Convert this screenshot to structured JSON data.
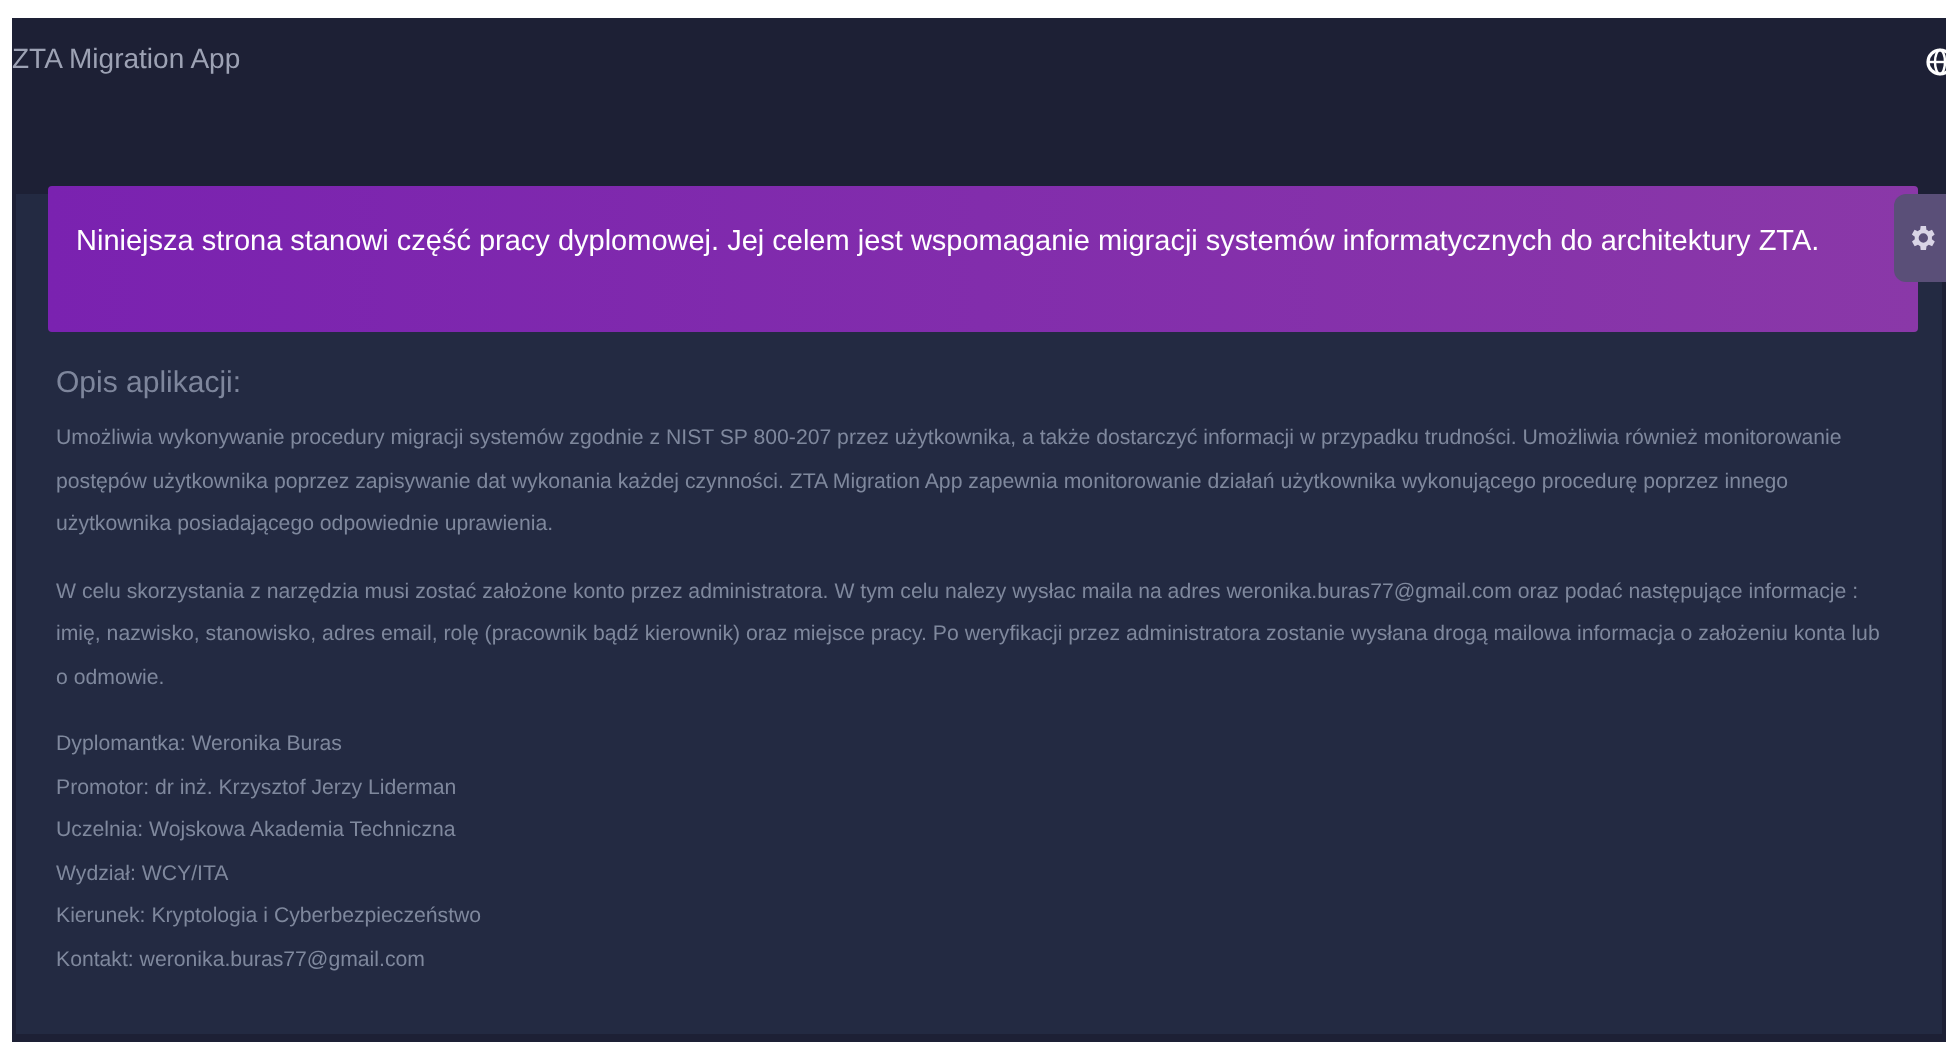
{
  "header": {
    "title": "ZTA Migration App"
  },
  "banner": {
    "text": "Niniejsza strona stanowi część pracy dyplomowej. Jej celem jest wspomaganie migracji systemów informatycznych do architektury ZTA."
  },
  "section": {
    "heading": "Opis aplikacji:",
    "paragraphs": [
      "Umożliwia wykonywanie procedury migracji systemów zgodnie z NIST SP 800-207 przez użytkownika, a także dostarczyć informacji w przypadku trudności. Umożliwia również monitorowanie postępów użytkownika poprzez zapisywanie dat wykonania każdej czynności. ZTA Migration App zapewnia monitorowanie działań użytkownika wykonującego procedurę poprzez innego użytkownika posiadającego odpowiednie uprawienia.",
      "W celu skorzystania z narzędzia musi zostać założone konto przez administratora. W tym celu nalezy wysłac maila na adres weronika.buras77@gmail.com oraz podać następujące informacje : imię, nazwisko, stanowisko, adres email, rolę (pracownik bądź kierownik) oraz miejsce pracy. Po weryfikacji przez administratora zostanie wysłana drogą mailowa informacja o założeniu konta lub o odmowie."
    ],
    "details": [
      "Dyplomantka: Weronika Buras",
      "Promotor: dr inż. Krzysztof Jerzy Liderman",
      "Uczelnia: Wojskowa Akademia Techniczna",
      "Wydział: WCY/ITA",
      "Kierunek: Kryptologia i Cyberbezpieczeństwo",
      "Kontakt: weronika.buras77@gmail.com"
    ]
  }
}
